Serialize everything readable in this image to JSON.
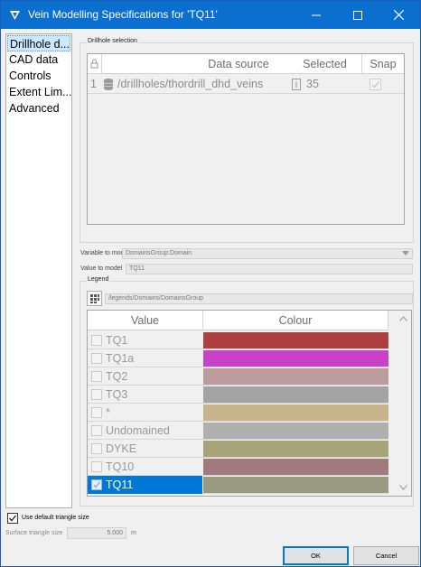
{
  "window": {
    "title": "Vein Modelling Specifications for 'TQ11'",
    "controls": [
      "minimize-icon",
      "maximize-icon",
      "close-icon"
    ]
  },
  "nav": {
    "items": [
      {
        "label": "Drillhole d...",
        "selected": true
      },
      {
        "label": "CAD data",
        "selected": false
      },
      {
        "label": "Controls",
        "selected": false
      },
      {
        "label": "Extent Lim...",
        "selected": false
      },
      {
        "label": "Advanced",
        "selected": false
      }
    ]
  },
  "drillhole_selection": {
    "group_label": "Drillhole selection",
    "columns": {
      "datasource": "Data source",
      "selected": "Selected",
      "snap": "Snap"
    },
    "lock_icon": "lock-icon",
    "rows": [
      {
        "index": "1",
        "icon": "database-icon",
        "datasource": "/drillholes/thordrill_dhd_veins",
        "selected": "35",
        "snap": true
      }
    ]
  },
  "variable": {
    "label": "Variable to model",
    "value": "DomainsGroup:Domain"
  },
  "value_to_model": {
    "label": "Value to model",
    "value": "TQ11"
  },
  "legend": {
    "group_label": "Legend",
    "path": "/legends/Domains/DomainsGroup",
    "columns": {
      "value": "Value",
      "colour": "Colour"
    },
    "rows": [
      {
        "value": "TQ1",
        "color": "#b04040",
        "checked": false,
        "selected": false
      },
      {
        "value": "TQ1a",
        "color": "#c940c9",
        "checked": false,
        "selected": false
      },
      {
        "value": "TQ2",
        "color": "#bb9c9c",
        "checked": false,
        "selected": false
      },
      {
        "value": "TQ3",
        "color": "#a3a3a3",
        "checked": false,
        "selected": false
      },
      {
        "value": "*",
        "color": "#c7b48a",
        "checked": false,
        "selected": false
      },
      {
        "value": "Undomained",
        "color": "#afafaf",
        "checked": false,
        "selected": false
      },
      {
        "value": "DYKE",
        "color": "#a8a47a",
        "checked": false,
        "selected": false
      },
      {
        "value": "TQ10",
        "color": "#a07a7c",
        "checked": false,
        "selected": false
      },
      {
        "value": "TQ11",
        "color": "#999a80",
        "checked": true,
        "selected": true
      }
    ]
  },
  "triangle": {
    "default_label": "Use default triangle size",
    "default_checked": true,
    "size_label": "Surface triangle size",
    "size_value": "5.000",
    "size_unit": "m"
  },
  "buttons": {
    "ok": "OK",
    "cancel": "Cancel"
  }
}
